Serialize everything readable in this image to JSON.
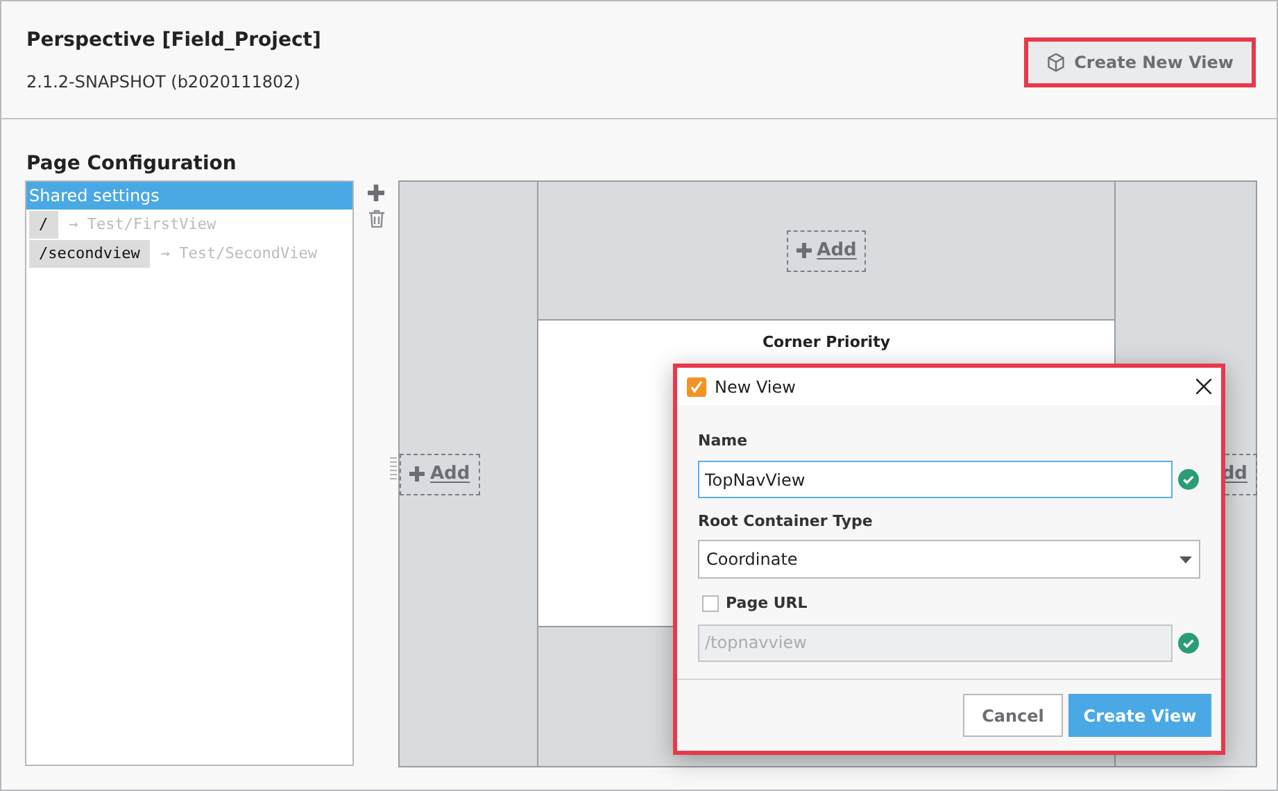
{
  "header": {
    "title": "Perspective [Field_Project]",
    "subtitle": "2.1.2-SNAPSHOT (b2020111802)",
    "button": "Create New View"
  },
  "section_title": "Page Configuration",
  "page_list": {
    "header": {
      "label": "Shared settings",
      "selected": true
    },
    "items": [
      {
        "path": "/",
        "view": "→ Test/FirstView",
        "selected": false
      },
      {
        "path": "/secondview",
        "view": "→ Test/SecondView",
        "selected": false
      }
    ]
  },
  "layout": {
    "top_add": "Add",
    "left_add": "Add",
    "right_add": "dd",
    "center_title": "Corner Priority"
  },
  "dialog": {
    "title": "New View",
    "name_label": "Name",
    "name_value": "TopNavView",
    "type_label": "Root Container Type",
    "type_value": "Coordinate",
    "url_label": "Page URL",
    "url_checked": false,
    "url_placeholder": "/topnavview",
    "buttons": [
      "Cancel",
      "Create View"
    ]
  }
}
